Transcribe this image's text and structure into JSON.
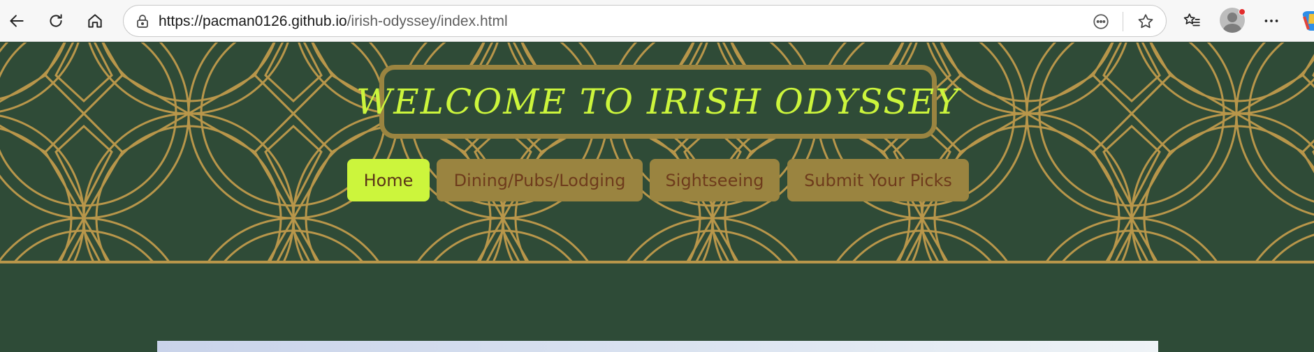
{
  "browser": {
    "url_host": "https://pacman0126.github.io",
    "url_path": "/irish-odyssey/index.html",
    "icons": [
      "back-arrow-icon",
      "refresh-icon",
      "home-icon",
      "site-info-icon",
      "reader-mode-icon",
      "star-icon",
      "favorites-icon",
      "profile-avatar",
      "more-icon",
      "copilot-icon"
    ]
  },
  "header": {
    "title": "WELCOME TO IRISH ODYSSEY"
  },
  "nav": {
    "items": [
      {
        "label": "Home",
        "active": true
      },
      {
        "label": "Dining/Pubs/Lodging",
        "active": false
      },
      {
        "label": "Sightseeing",
        "active": false
      },
      {
        "label": "Submit Your Picks",
        "active": false
      }
    ]
  },
  "colors": {
    "background": "#2e4b37",
    "pattern_gold": "#b8964a",
    "title_text": "#ccf53c",
    "nav_active": "#ccf53c",
    "nav_inactive": "#9a8440",
    "nav_text": "#6e3b1c"
  }
}
